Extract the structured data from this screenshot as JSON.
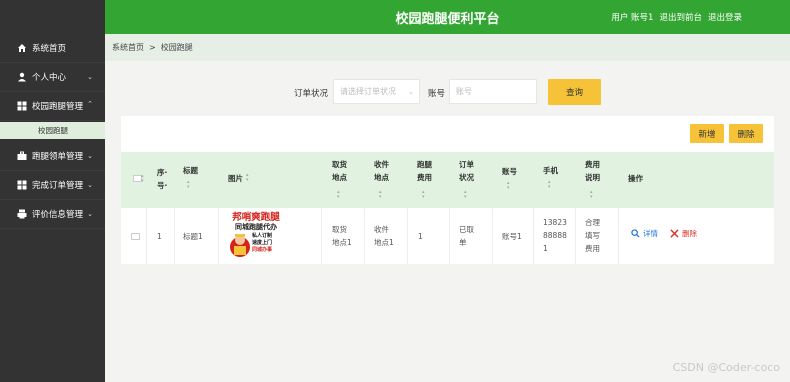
{
  "app": {
    "title": "校园跑腿便利平台",
    "user_label": "用户 账号1",
    "back_front": "退出到前台",
    "logout": "退出登录"
  },
  "sidebar": {
    "items": [
      {
        "label": "系统首页",
        "icon": "home-icon"
      },
      {
        "label": "个人中心",
        "icon": "user-icon"
      },
      {
        "label": "校园跑腿管理",
        "icon": "grid-icon"
      },
      {
        "label": "跑腿领单管理",
        "icon": "briefcase-icon"
      },
      {
        "label": "完成订单管理",
        "icon": "grid-icon"
      },
      {
        "label": "评价信息管理",
        "icon": "printer-icon"
      }
    ],
    "sub_item": "校园跑腿"
  },
  "breadcrumb": {
    "home": "系统首页",
    "sep": ">",
    "current": "校园跑腿"
  },
  "search": {
    "status_label": "订单状况",
    "status_placeholder": "请选择订单状况",
    "account_label": "账号",
    "account_placeholder": "账号",
    "query_button": "查询"
  },
  "toolbar": {
    "add": "新增",
    "delete": "删除"
  },
  "table": {
    "headers": {
      "index": [
        "序·",
        "号·"
      ],
      "title": "标题",
      "image": "图片",
      "pickup": [
        "取货",
        "地点"
      ],
      "receive": [
        "收件",
        "地点"
      ],
      "fee": [
        "跑腿",
        "费用"
      ],
      "status": [
        "订单",
        "状况"
      ],
      "account": "账号",
      "phone": "手机",
      "fee_note": [
        "费用",
        "说明"
      ],
      "actions": "操作"
    },
    "rows": [
      {
        "index": "1",
        "title": "标题1",
        "pickup": [
          "取货",
          "地点1"
        ],
        "receive": [
          "收件",
          "地点1"
        ],
        "fee": "1",
        "status": [
          "已取",
          "单"
        ],
        "account": "账号1",
        "phone": [
          "13823",
          "88888",
          "1"
        ],
        "fee_note": [
          "合理",
          "填写",
          "费用"
        ],
        "detail": "详情",
        "delete": "删除",
        "image": {
          "headline": "邦哨爽跑腿",
          "subline": "同城跑腿代办",
          "tags": [
            "私人订制",
            "速度上门",
            "同城办事"
          ]
        }
      }
    ]
  },
  "colors": {
    "green": "#32a532",
    "sidebar": "#333333",
    "yellow": "#f6c338",
    "header_bg": "#e1f3e0",
    "delete_red": "#d93025",
    "detail_blue": "#1e73d8"
  },
  "watermark": "CSDN @Coder-coco"
}
